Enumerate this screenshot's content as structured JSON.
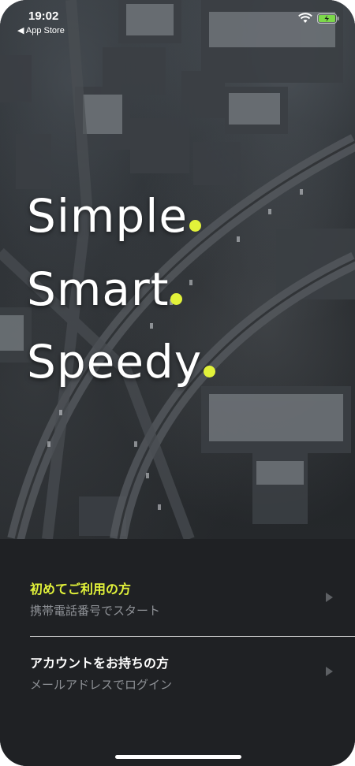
{
  "status_bar": {
    "time": "19:02",
    "back_label": "◀ App Store"
  },
  "headline": {
    "line1": "Simple",
    "line2": "Smart",
    "line3": "Speedy",
    "dot_color": "#e2f23a"
  },
  "options": [
    {
      "title": "初めてご利用の方",
      "subtitle": "携帯電話番号でスタート",
      "title_color": "#e2f23a"
    },
    {
      "title": "アカウントをお持ちの方",
      "subtitle": "メールアドレスでログイン",
      "title_color": "#ffffff"
    }
  ],
  "icons": {
    "wifi": "wifi-icon",
    "battery": "battery-charging-icon",
    "chevron": "chevron-right-icon"
  },
  "colors": {
    "accent": "#e2f23a",
    "sheet_background": "#1f2124",
    "subtitle_text": "#8e9196"
  }
}
